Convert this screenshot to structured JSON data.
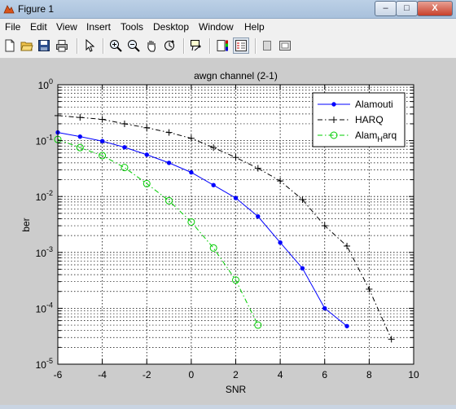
{
  "window": {
    "title": "Figure 1",
    "min_label": "–",
    "max_label": "□",
    "close_label": "X"
  },
  "menu": [
    "File",
    "Edit",
    "View",
    "Insert",
    "Tools",
    "Desktop",
    "Window",
    "Help"
  ],
  "toolbar": {
    "buttons": [
      "new-figure",
      "open-file",
      "save-figure",
      "print-figure",
      "edit-plot",
      "zoom-in",
      "zoom-out",
      "pan",
      "rotate-3d",
      "data-cursor",
      "insert-colorbar",
      "insert-legend",
      "hide-plot-tools",
      "show-plot-tools"
    ]
  },
  "colors": {
    "alamouti": "#0000ff",
    "harq": "#000000",
    "alam_harq": "#00cc00",
    "grid": "#000000",
    "figure_bg": "#cccccc",
    "axes_bg": "#ffffff"
  },
  "chart_data": {
    "type": "line",
    "title": "awgn channel (2-1)",
    "xlabel": "SNR",
    "ylabel": "ber",
    "xlim": [
      -6,
      10
    ],
    "ylim": [
      1e-05,
      1
    ],
    "yscale": "log",
    "grid": true,
    "minor_grid": true,
    "legend_position": "top-right",
    "xticks": [
      "-6",
      "-4",
      "-2",
      "0",
      "2",
      "4",
      "6",
      "8",
      "10"
    ],
    "yticks": [
      {
        "base": "10",
        "exp": "0"
      },
      {
        "base": "10",
        "exp": "-1"
      },
      {
        "base": "10",
        "exp": "-2"
      },
      {
        "base": "10",
        "exp": "-3"
      },
      {
        "base": "10",
        "exp": "-4"
      },
      {
        "base": "10",
        "exp": "-5"
      }
    ],
    "series": [
      {
        "name": "Alamouti",
        "color": "#0000ff",
        "line": "solid",
        "marker": "dot",
        "x": [
          -6,
          -5,
          -4,
          -3,
          -2,
          -1,
          0,
          1,
          2,
          3,
          4,
          5,
          6,
          7
        ],
        "y": [
          0.14,
          0.118,
          0.098,
          0.076,
          0.056,
          0.04,
          0.027,
          0.016,
          0.0094,
          0.0044,
          0.0015,
          0.00052,
          0.0001,
          4.8e-05
        ]
      },
      {
        "name": "HARQ",
        "color": "#000000",
        "line": "dashdot",
        "marker": "plus",
        "x": [
          -6,
          -5,
          -4,
          -3,
          -2,
          -1,
          0,
          1,
          2,
          3,
          4,
          5,
          6,
          7,
          8,
          9
        ],
        "y": [
          0.28,
          0.26,
          0.24,
          0.2,
          0.17,
          0.14,
          0.11,
          0.075,
          0.05,
          0.032,
          0.019,
          0.0088,
          0.003,
          0.0013,
          0.00022,
          2.8e-05
        ]
      },
      {
        "name": "Alam",
        "name_sub": "H",
        "name_suffix": "arq",
        "color": "#00cc00",
        "line": "dashdot",
        "marker": "circle",
        "x": [
          -6,
          -5,
          -4,
          -3,
          -2,
          -1,
          0,
          1,
          2,
          3
        ],
        "y": [
          0.105,
          0.075,
          0.054,
          0.033,
          0.017,
          0.0084,
          0.0035,
          0.0012,
          0.00032,
          5e-05
        ]
      }
    ]
  }
}
